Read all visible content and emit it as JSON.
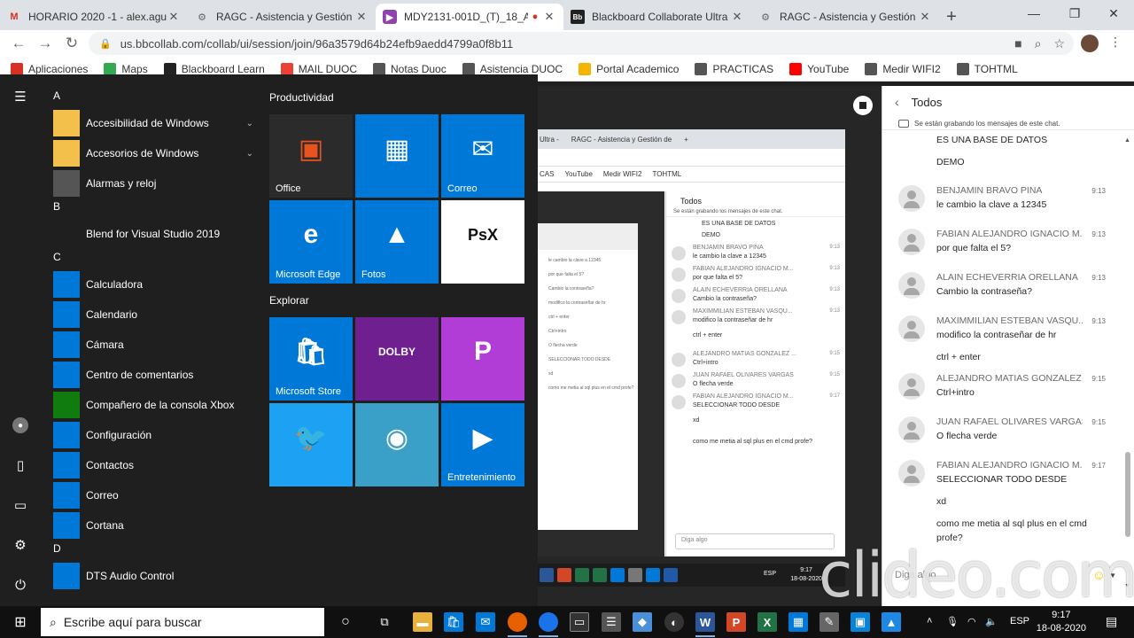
{
  "browser": {
    "tabs": [
      {
        "title": "HORARIO 2020 -1 - alex.aguile",
        "favicon": "gmail-icon",
        "active": false
      },
      {
        "title": "RAGC - Asistencia y Gestión de",
        "favicon": "ragc-icon",
        "active": false
      },
      {
        "title": "MDY2131-001D_(T)_18_AG",
        "favicon": "purple-icon",
        "active": true
      },
      {
        "title": "Blackboard Collaborate Ultra -",
        "favicon": "bb-icon",
        "active": false
      },
      {
        "title": "RAGC - Asistencia y Gestión de",
        "favicon": "ragc-icon",
        "active": false
      }
    ],
    "url": "us.bbcollab.com/collab/ui/session/join/96a3579d64b24efb9aedd4799a0f8b11",
    "bookmarks": [
      {
        "label": "Aplicaciones",
        "icon": "apps-grid-icon",
        "color": "#d93025"
      },
      {
        "label": "Maps",
        "icon": "maps-icon",
        "color": "#34a853"
      },
      {
        "label": "Blackboard Learn",
        "icon": "bb-icon",
        "color": "#222222"
      },
      {
        "label": "MAIL DUOC",
        "icon": "gmail-icon",
        "color": "#ea4335"
      },
      {
        "label": "Notas Duoc",
        "icon": "globe-icon",
        "color": "#555555"
      },
      {
        "label": "Asistencia DUOC",
        "icon": "globe-icon",
        "color": "#555555"
      },
      {
        "label": "Portal Academico",
        "icon": "folder-icon",
        "color": "#f4b400"
      },
      {
        "label": "PRACTICAS",
        "icon": "globe-icon",
        "color": "#555555"
      },
      {
        "label": "YouTube",
        "icon": "youtube-icon",
        "color": "#ff0000"
      },
      {
        "label": "Medir WIFI2",
        "icon": "globe-icon",
        "color": "#555555"
      },
      {
        "label": "TOHTML",
        "icon": "globe-icon",
        "color": "#555555"
      }
    ]
  },
  "chat": {
    "title": "Todos",
    "recording_notice": "Se están grabando los mensajes de este chat.",
    "top_lines": [
      "ES UNA BASE DE DATOS",
      "DEMO"
    ],
    "messages": [
      {
        "name": "BENJAMIN BRAVO PINA",
        "time": "9:13",
        "lines": [
          "le cambio la clave a 12345"
        ]
      },
      {
        "name": "FABIAN ALEJANDRO IGNACIO M...",
        "time": "9:13",
        "lines": [
          "por que falta el 5?"
        ]
      },
      {
        "name": "ALAIN ECHEVERRIA ORELLANA",
        "time": "9:13",
        "lines": [
          "Cambio la contraseña?"
        ]
      },
      {
        "name": "MAXIMMILIAN ESTEBAN VASQU...",
        "time": "9:13",
        "lines": [
          "modifico la contraseñar de hr",
          "ctrl + enter"
        ]
      },
      {
        "name": "ALEJANDRO MATIAS GONZALEZ ...",
        "time": "9:15",
        "lines": [
          "Ctrl+intro"
        ]
      },
      {
        "name": "JUAN RAFAEL OLIVARES VARGAS",
        "time": "9:15",
        "lines": [
          "O flecha verde"
        ]
      },
      {
        "name": "FABIAN ALEJANDRO IGNACIO M...",
        "time": "9:17",
        "lines": [
          "SELECCIONAR TODO DESDE",
          "xd",
          "como me metia al sql plus en el cmd",
          "profe?"
        ]
      }
    ],
    "input_placeholder": "Diga algo",
    "watermark": "clideo.com"
  },
  "nested": {
    "tabs": [
      "Ultra -",
      "RAGC - Asistencia y Gestión de",
      "+"
    ],
    "bookmarks": [
      "CAS",
      "YouTube",
      "Medir WIFI2",
      "TOHTML"
    ],
    "chat_title": "Todos",
    "recording_notice": "Se están grabando los mensajes de este chat.",
    "lines": [
      "ES UNA BASE DE DATOS",
      "DEMO"
    ],
    "messages": [
      {
        "name": "BENJAMIN BRAVO PINA",
        "time": "9:13",
        "text": "le cambio la clave a 12345"
      },
      {
        "name": "FABIAN ALEJANDRO IGNACIO M...",
        "time": "9:13",
        "text": "por que falta el 5?"
      },
      {
        "name": "ALAIN ECHEVERRIA ORELLANA",
        "time": "9:13",
        "text": "Cambio la contraseña?"
      },
      {
        "name": "MAXIMMILIAN ESTEBAN VASQU...",
        "time": "9:13",
        "text": "modifico la contraseñar de hr"
      },
      {
        "name": "",
        "time": "",
        "text": "ctrl + enter"
      },
      {
        "name": "ALEJANDRO MATIAS GONZALEZ ...",
        "time": "9:15",
        "text": "Ctrl+intro"
      },
      {
        "name": "JUAN RAFAEL OLIVARES VARGAS",
        "time": "9:15",
        "text": "O flecha verde"
      },
      {
        "name": "FABIAN ALEJANDRO IGNACIO M...",
        "time": "9:17",
        "text": "SELECCIONAR TODO DESDE"
      },
      {
        "name": "",
        "time": "",
        "text": "xd"
      },
      {
        "name": "",
        "time": "",
        "text": "como me metia al sql plus en el cmd profe?"
      }
    ],
    "input_placeholder": "Diga algo",
    "lang": "ESP",
    "time": "9:17",
    "date": "18-08-2020"
  },
  "start_menu": {
    "apps": [
      {
        "type": "letter",
        "text": "A"
      },
      {
        "type": "app",
        "label": "Accesibilidad de Windows",
        "icon": "folder-icon",
        "color": "#f3c14b",
        "expand": true
      },
      {
        "type": "app",
        "label": "Accesorios de Windows",
        "icon": "folder-icon",
        "color": "#f3c14b",
        "expand": true
      },
      {
        "type": "app",
        "label": "Alarmas y reloj",
        "icon": "clock-icon",
        "color": "#555555",
        "expand": false
      },
      {
        "type": "letter",
        "text": "B"
      },
      {
        "type": "app",
        "label": "Blend for Visual Studio 2019",
        "icon": "blend-icon",
        "color": "#1f1f1f",
        "expand": false
      },
      {
        "type": "letter",
        "text": "C"
      },
      {
        "type": "app",
        "label": "Calculadora",
        "icon": "calculator-icon",
        "color": "#0078d7",
        "expand": false
      },
      {
        "type": "app",
        "label": "Calendario",
        "icon": "calendar-icon",
        "color": "#0078d7",
        "expand": false
      },
      {
        "type": "app",
        "label": "Cámara",
        "icon": "camera-icon",
        "color": "#0078d7",
        "expand": false
      },
      {
        "type": "app",
        "label": "Centro de comentarios",
        "icon": "feedback-icon",
        "color": "#0078d7",
        "expand": false
      },
      {
        "type": "app",
        "label": "Compañero de la consola Xbox",
        "icon": "xbox-icon",
        "color": "#107c10",
        "expand": false
      },
      {
        "type": "app",
        "label": "Configuración",
        "icon": "gear-icon",
        "color": "#0078d7",
        "expand": false
      },
      {
        "type": "app",
        "label": "Contactos",
        "icon": "contacts-icon",
        "color": "#0078d7",
        "expand": false
      },
      {
        "type": "app",
        "label": "Correo",
        "icon": "mail-icon",
        "color": "#0078d7",
        "expand": false
      },
      {
        "type": "app",
        "label": "Cortana",
        "icon": "cortana-icon",
        "color": "#0078d7",
        "expand": false
      },
      {
        "type": "letter",
        "text": "D"
      },
      {
        "type": "app",
        "label": "DTS Audio Control",
        "icon": "dts-icon",
        "color": "#0078d7",
        "expand": false
      }
    ],
    "groups": [
      {
        "label": "Productividad"
      },
      {
        "label": "Explorar"
      }
    ],
    "tiles": [
      {
        "label": "Office",
        "icon": "office-icon",
        "bg": "#2b2b2b"
      },
      {
        "label": "",
        "icon": "office-apps-icon",
        "bg": "#0078d7"
      },
      {
        "label": "Correo",
        "icon": "mail-icon",
        "bg": "#0078d7"
      },
      {
        "label": "Microsoft Edge",
        "icon": "edge-icon",
        "bg": "#0078d7"
      },
      {
        "label": "Fotos",
        "icon": "photos-icon",
        "bg": "#0078d7"
      },
      {
        "label": "",
        "icon": "psx-icon",
        "bg": "#ffffff"
      },
      {
        "label": "Microsoft Store",
        "icon": "store-icon",
        "bg": "#0078d7"
      },
      {
        "label": "",
        "icon": "dolby-icon",
        "bg": "#6f1f8f"
      },
      {
        "label": "",
        "icon": "picsart-icon",
        "bg": "#b23cd6"
      },
      {
        "label": "",
        "icon": "twitter-icon",
        "bg": "#1da1f2"
      },
      {
        "label": "",
        "icon": "fish-game-icon",
        "bg": "#3aa0c8"
      },
      {
        "label": "Entretenimiento",
        "icon": "entertainment-icon",
        "bg": "#0078d7"
      }
    ],
    "rail": [
      "hamburger-icon",
      "user-icon",
      "documents-icon",
      "pictures-icon",
      "gear-icon",
      "power-icon"
    ]
  },
  "taskbar": {
    "search_placeholder": "Escribe aquí para buscar",
    "lang": "ESP",
    "time": "9:17",
    "date": "18-08-2020"
  }
}
